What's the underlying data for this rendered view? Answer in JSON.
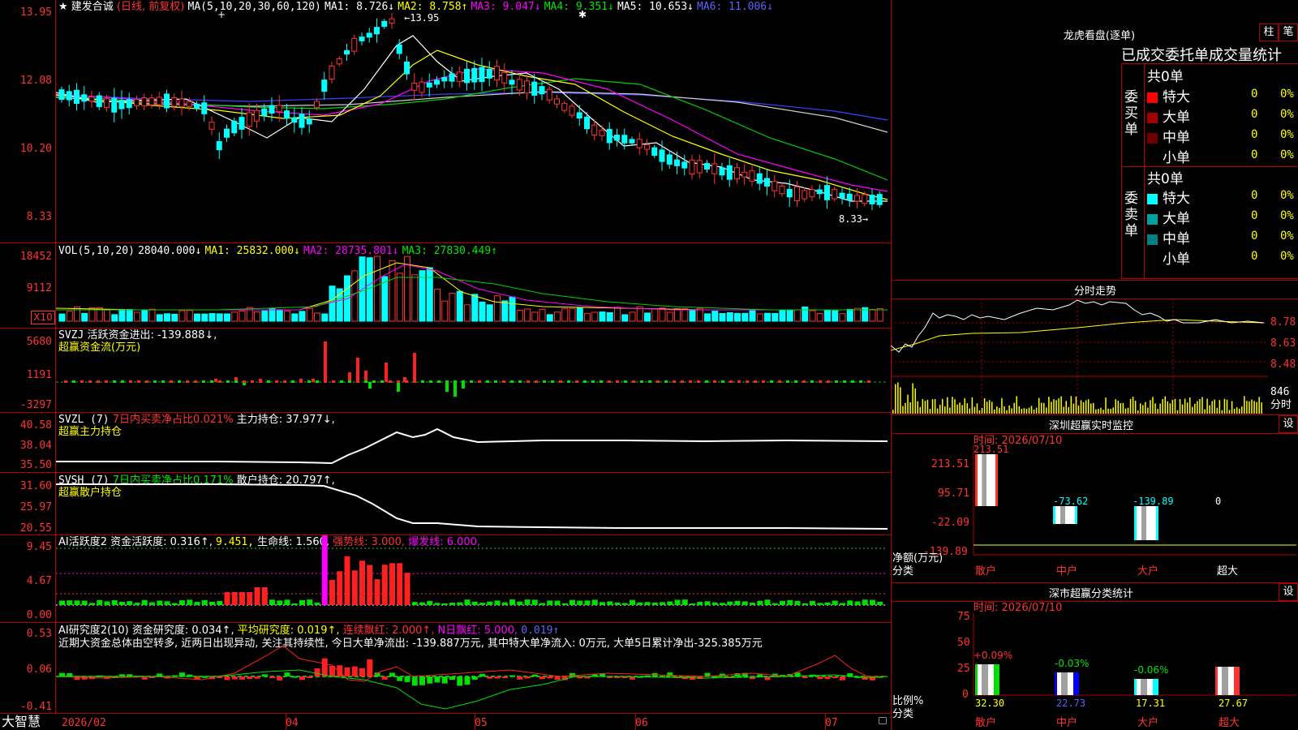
{
  "main_panel": {
    "star": "★",
    "stock_name": "建发合诚",
    "period": "(日线, 前复权)",
    "ma_params": "MA(5,10,20,30,60,120)",
    "ma1": "MA1: 8.726↓",
    "ma2": "MA2: 8.758↑",
    "ma3": "MA3: 9.047↓",
    "ma4": "MA4: 9.351↓",
    "ma5": "MA5: 10.653↓",
    "ma6": "MA6: 11.006↓",
    "y_labels": [
      "13.95",
      "12.08",
      "10.20",
      "8.33"
    ],
    "high_mark": "←13.95",
    "low_mark": "8.33→",
    "markers": [
      "+",
      "✱"
    ]
  },
  "vol_panel": {
    "label": "VOL(5,10,20)",
    "value": "28040.000↓",
    "ma1": "MA1: 25832.000↓",
    "ma2": "MA2: 28735.801↓",
    "ma3": "MA3: 27830.449↑",
    "y_labels": [
      "18452",
      "9112",
      "X10"
    ]
  },
  "svzj_panel": {
    "label": "SVZJ",
    "desc": "活跃资金进出: -139.888↓,",
    "subtitle": "超赢资金流(万元)",
    "y_labels": [
      "5680",
      "1191",
      "-3297"
    ]
  },
  "svzl_panel": {
    "label": "SVZL (7)",
    "desc": "7日内买卖净占比0.021%",
    "value": "主力持仓: 37.977↓,",
    "subtitle": "超赢主力持仓",
    "y_labels": [
      "40.58",
      "38.04",
      "35.50"
    ]
  },
  "svsh_panel": {
    "label": "SVSH (7)",
    "desc": "7日内买卖净占比0.171%",
    "value": "散户持仓: 20.797↑,",
    "subtitle": "超赢散户持仓",
    "y_labels": [
      "31.60",
      "25.97",
      "20.55"
    ]
  },
  "ai_active_panel": {
    "label": "AI活跃度2",
    "value1": "资金活跃度: 0.316↑,",
    "value2": "9.451,",
    "value3": "生命线: 1.560,",
    "value4": "强势线: 3.000,",
    "value5": "爆发线: 6.000,",
    "y_labels": [
      "9.45",
      "4.67",
      "0.00"
    ]
  },
  "ai_research_panel": {
    "label": "AI研究度2(10)",
    "value1": "资金研究度: 0.034↑,",
    "value2": "平均研究度: 0.019↑,",
    "value3": "连续飘红: 2.000↑,",
    "value4": "N日飘红: 5.000,",
    "value5": "0.019↑",
    "commentary": "近期大资金总体由空转多, 近两日出现异动, 关注其持续性, 今日大单净流出: -139.887万元, 其中特大单净流入: 0万元, 大单5日累计净出-325.385万元",
    "y_labels": [
      "0.53",
      "0.06",
      "-0.41"
    ]
  },
  "x_axis": {
    "brand": "大智慧",
    "labels": [
      "2026/02",
      "04",
      "05",
      "06",
      "07"
    ]
  },
  "dragon_tiger": {
    "title": "龙虎看盘(逐单)",
    "btn_zhu": "柱",
    "btn_bi": "笔",
    "tab_trade": "已成交",
    "tab_order": "委托单",
    "tab_volume": "成交量",
    "tab_stat": "统计",
    "buy_label": "委买单",
    "sell_label": "委卖单",
    "buy_total": "共0单",
    "sell_total": "共0单",
    "buy_rows": [
      {
        "name": "特大",
        "count": "0",
        "pct": "0%",
        "color": "#ff0000"
      },
      {
        "name": "大单",
        "count": "0",
        "pct": "0%",
        "color": "#a00000"
      },
      {
        "name": "中单",
        "count": "0",
        "pct": "0%",
        "color": "#700000"
      },
      {
        "name": "小单",
        "count": "0",
        "pct": "0%",
        "color": "#000000"
      }
    ],
    "sell_rows": [
      {
        "name": "特大",
        "count": "0",
        "pct": "0%",
        "color": "#00ffff"
      },
      {
        "name": "大单",
        "count": "0",
        "pct": "0%",
        "color": "#00a0a0"
      },
      {
        "name": "中单",
        "count": "0",
        "pct": "0%",
        "color": "#008080"
      },
      {
        "name": "小单",
        "count": "0",
        "pct": "0%",
        "color": "#000000"
      }
    ]
  },
  "intraday": {
    "title": "分时走势",
    "y_labels": [
      "8.78",
      "8.63",
      "8.48"
    ],
    "vol_label": "846",
    "vol_unit": "分时"
  },
  "realtime_monitor": {
    "title": "深圳超赢实时监控",
    "btn": "设",
    "time": "时间: 2026/07/10",
    "y_labels": [
      "213.51",
      "95.71",
      "-22.09",
      "-139.89"
    ],
    "unit": "净额(万元)",
    "cat_label": "分类",
    "categories": [
      "散户",
      "中户",
      "大户",
      "超大"
    ],
    "values": [
      "213.51",
      "-73.62",
      "-139.89",
      "0"
    ]
  },
  "classify_stat": {
    "title": "深市超赢分类统计",
    "btn": "设",
    "time": "时间: 2026/07/10",
    "y_labels": [
      "75",
      "50",
      "25",
      "0"
    ],
    "unit": "比例%",
    "cat_label": "分类",
    "categories": [
      "散户",
      "中户",
      "大户",
      "超大"
    ],
    "top_values": [
      "+0.09%",
      "-0.03%",
      "-0.06%"
    ],
    "bottom_values": [
      "32.30",
      "22.73",
      "17.31",
      "27.67"
    ]
  }
}
